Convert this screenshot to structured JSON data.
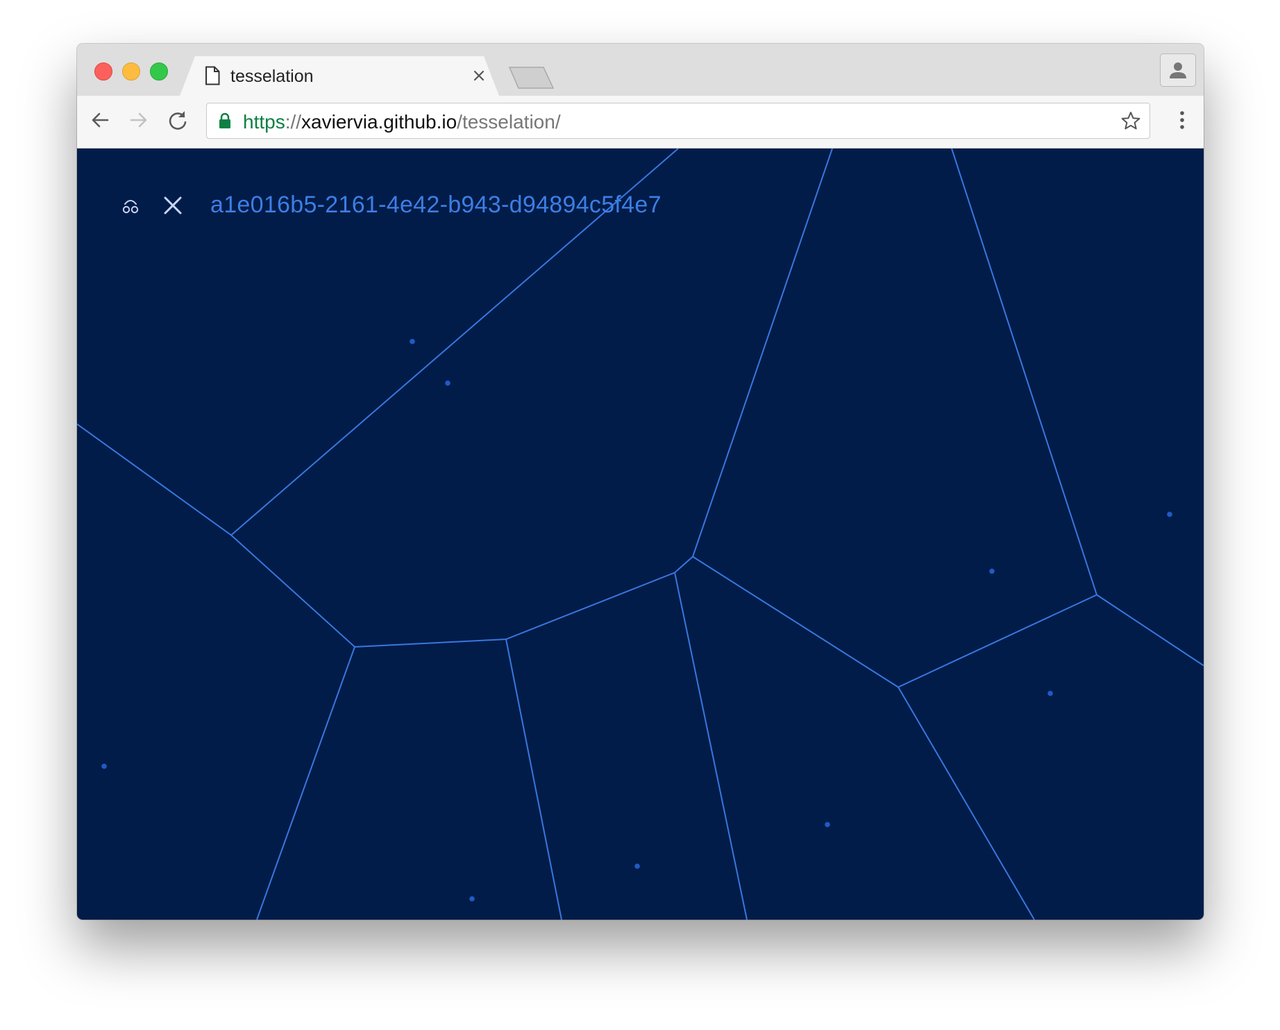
{
  "browser": {
    "tab": {
      "title": "tesselation",
      "icon": "page-icon"
    },
    "address": {
      "scheme": "https",
      "separator": "://",
      "host": "xavierviagithub.io",
      "host_display": "xaviervia.github.io",
      "path": "/tesselation/"
    }
  },
  "page": {
    "seed_id": "a1e016b5-2161-4e42-b943-d94894c5f4e7",
    "controls": {
      "shuffle_icon": "shuffle-icon",
      "close_icon": "close-icon"
    }
  },
  "colors": {
    "background": "#021c49",
    "edge": "#3877e0",
    "site": "#1f5bc4",
    "seed_text": "#3d7ee5"
  }
}
